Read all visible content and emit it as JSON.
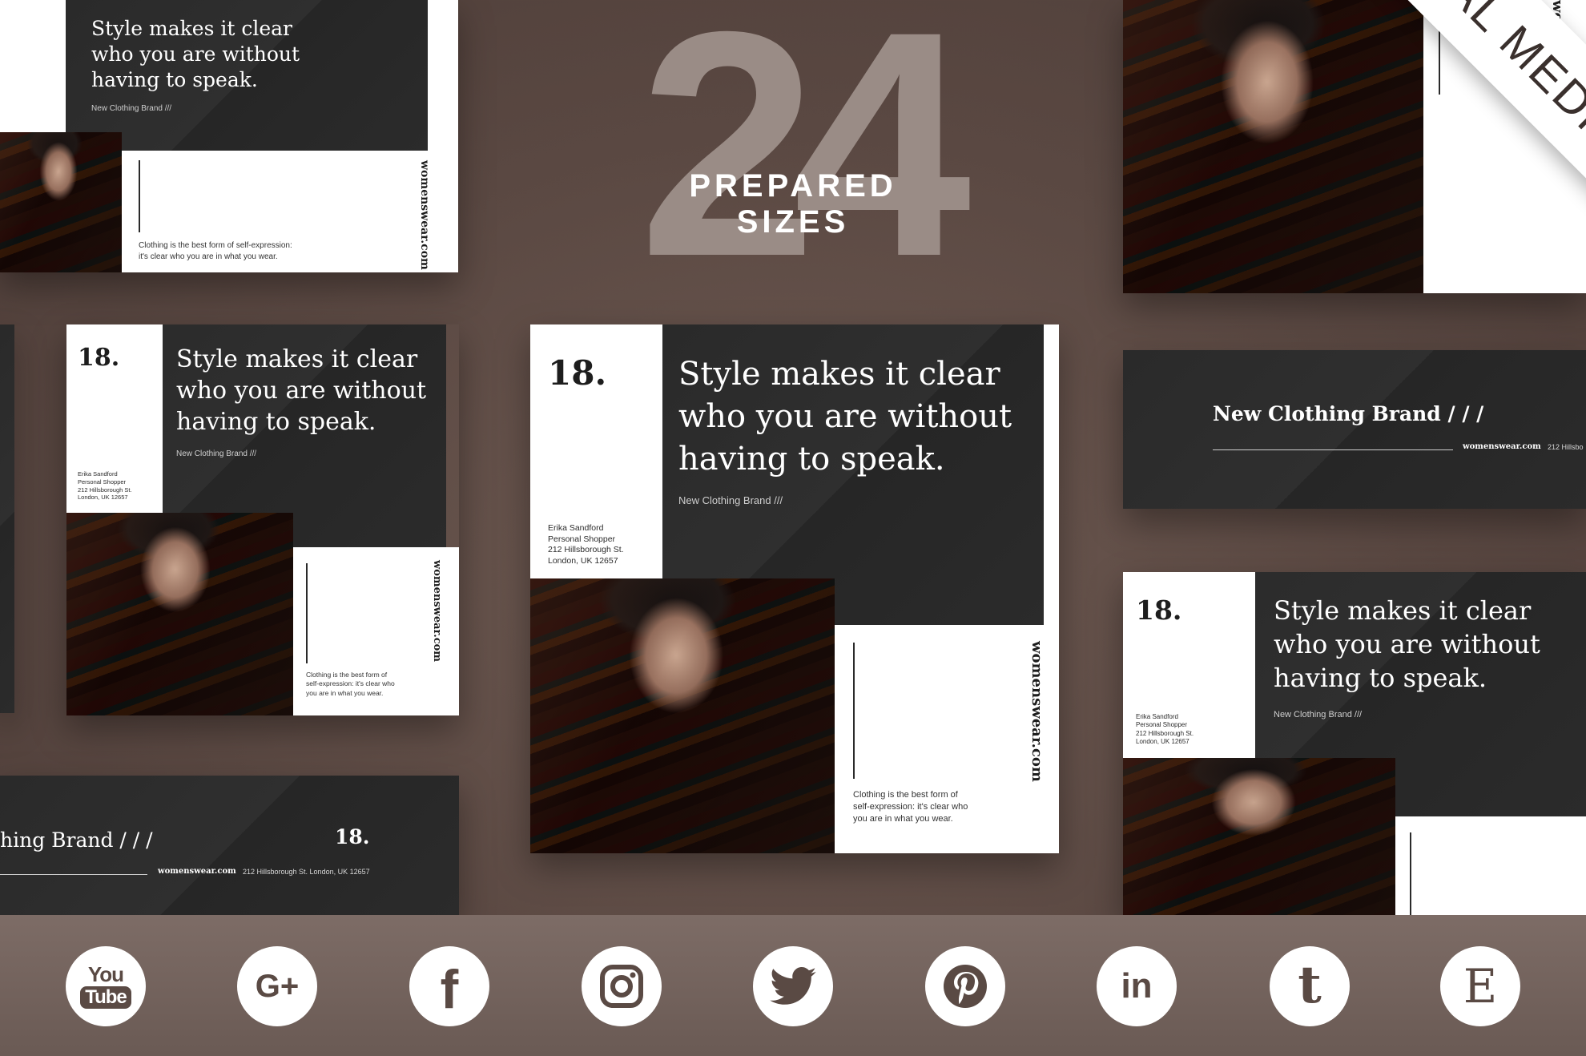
{
  "headline": {
    "number": "24",
    "subtitle": "PREPARED SIZES"
  },
  "ribbon": {
    "text": "SOCIAL MEDIA PACK"
  },
  "template": {
    "quote_line1": "Style makes it clear",
    "quote_line2": "who you are without",
    "quote_line3": "having to speak.",
    "brand_small": "New Clothing Brand ///",
    "brand_large": "New Clothing Brand / / /",
    "brand_cut": "hing Brand / / /",
    "number": "18.",
    "website": "womenswear.com",
    "tagline_line1": "Clothing is the best form of self-expression:",
    "tagline_line2": "it's clear who you are in what you wear.",
    "tagline_short1": "Clothing is the best form of",
    "tagline_short2": "self-expression: it's clear who",
    "tagline_short3": "you are in what you wear.",
    "contact_name": "Erika Sandford",
    "contact_role": "Personal Shopper",
    "contact_street": "212 Hillsborough St.",
    "contact_city": "London, UK 12657",
    "address_inline": "212 Hillsborough St. London, UK 12657",
    "address_cut": "212 Hillsbo"
  },
  "social_icons": [
    {
      "name": "youtube-icon",
      "label_top": "You",
      "label_bottom": "Tube"
    },
    {
      "name": "google-plus-icon",
      "label": "G+"
    },
    {
      "name": "facebook-icon",
      "label": "f"
    },
    {
      "name": "instagram-icon"
    },
    {
      "name": "twitter-icon"
    },
    {
      "name": "pinterest-icon"
    },
    {
      "name": "linkedin-icon",
      "label": "in"
    },
    {
      "name": "tumblr-icon",
      "label": "t"
    },
    {
      "name": "etsy-icon",
      "label": "E"
    }
  ],
  "colors": {
    "background": "#5a4842",
    "dark_panel": "#2b2b2b",
    "accent_number": "#9a8c86",
    "bottom_bar": "#736360"
  }
}
